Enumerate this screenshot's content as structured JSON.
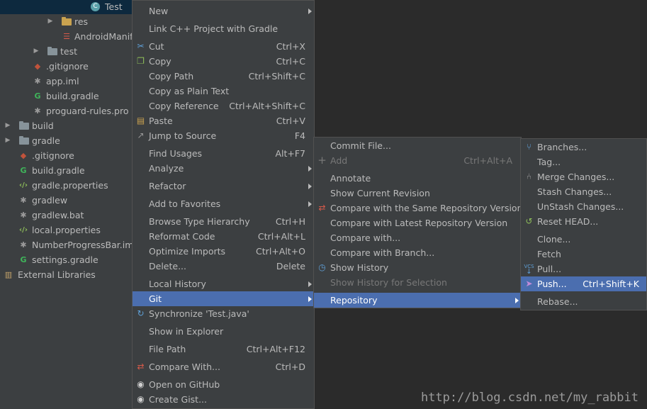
{
  "tree": {
    "items": [
      {
        "label": "Test",
        "icon": "class-icon"
      },
      {
        "label": "res",
        "icon": "folder-icon"
      },
      {
        "label": "AndroidManif",
        "icon": "xml-icon"
      },
      {
        "label": "test",
        "icon": "folder-icon"
      },
      {
        "label": ".gitignore",
        "icon": "git-icon"
      },
      {
        "label": "app.iml",
        "icon": "file-icon"
      },
      {
        "label": "build.gradle",
        "icon": "gradle-icon"
      },
      {
        "label": "proguard-rules.pro",
        "icon": "file-icon"
      },
      {
        "label": "build",
        "icon": "folder-icon"
      },
      {
        "label": "gradle",
        "icon": "folder-icon"
      },
      {
        "label": ".gitignore",
        "icon": "git-icon"
      },
      {
        "label": "build.gradle",
        "icon": "gradle-icon"
      },
      {
        "label": "gradle.properties",
        "icon": "properties-icon"
      },
      {
        "label": "gradlew",
        "icon": "file-icon"
      },
      {
        "label": "gradlew.bat",
        "icon": "file-icon"
      },
      {
        "label": "local.properties",
        "icon": "properties-icon"
      },
      {
        "label": "NumberProgressBar.iml",
        "icon": "file-icon"
      },
      {
        "label": "settings.gradle",
        "icon": "gradle-icon"
      },
      {
        "label": "External Libraries",
        "icon": "library-icon"
      }
    ]
  },
  "context_menu": {
    "items": [
      {
        "label": "New",
        "shortcut": ""
      },
      {
        "label": "Link C++ Project with Gradle",
        "shortcut": ""
      },
      {
        "label": "Cut",
        "shortcut": "Ctrl+X"
      },
      {
        "label": "Copy",
        "shortcut": "Ctrl+C"
      },
      {
        "label": "Copy Path",
        "shortcut": "Ctrl+Shift+C"
      },
      {
        "label": "Copy as Plain Text",
        "shortcut": ""
      },
      {
        "label": "Copy Reference",
        "shortcut": "Ctrl+Alt+Shift+C"
      },
      {
        "label": "Paste",
        "shortcut": "Ctrl+V"
      },
      {
        "label": "Jump to Source",
        "shortcut": "F4"
      },
      {
        "label": "Find Usages",
        "shortcut": "Alt+F7"
      },
      {
        "label": "Analyze",
        "shortcut": ""
      },
      {
        "label": "Refactor",
        "shortcut": ""
      },
      {
        "label": "Add to Favorites",
        "shortcut": ""
      },
      {
        "label": "Browse Type Hierarchy",
        "shortcut": "Ctrl+H"
      },
      {
        "label": "Reformat Code",
        "shortcut": "Ctrl+Alt+L"
      },
      {
        "label": "Optimize Imports",
        "shortcut": "Ctrl+Alt+O"
      },
      {
        "label": "Delete...",
        "shortcut": "Delete"
      },
      {
        "label": "Local History",
        "shortcut": ""
      },
      {
        "label": "Git",
        "shortcut": ""
      },
      {
        "label": "Synchronize 'Test.java'",
        "shortcut": ""
      },
      {
        "label": "Show in Explorer",
        "shortcut": ""
      },
      {
        "label": "File Path",
        "shortcut": "Ctrl+Alt+F12"
      },
      {
        "label": "Compare With...",
        "shortcut": "Ctrl+D"
      },
      {
        "label": "Open on GitHub",
        "shortcut": ""
      },
      {
        "label": "Create Gist...",
        "shortcut": ""
      }
    ]
  },
  "git_menu": {
    "items": [
      {
        "label": "Commit File...",
        "shortcut": ""
      },
      {
        "label": "Add",
        "shortcut": "Ctrl+Alt+A"
      },
      {
        "label": "Annotate",
        "shortcut": ""
      },
      {
        "label": "Show Current Revision",
        "shortcut": ""
      },
      {
        "label": "Compare with the Same Repository Version",
        "shortcut": ""
      },
      {
        "label": "Compare with Latest Repository Version",
        "shortcut": ""
      },
      {
        "label": "Compare with...",
        "shortcut": ""
      },
      {
        "label": "Compare with Branch...",
        "shortcut": ""
      },
      {
        "label": "Show History",
        "shortcut": ""
      },
      {
        "label": "Show History for Selection",
        "shortcut": ""
      },
      {
        "label": "Repository",
        "shortcut": ""
      }
    ]
  },
  "repository_menu": {
    "items": [
      {
        "label": "Branches...",
        "shortcut": ""
      },
      {
        "label": "Tag...",
        "shortcut": ""
      },
      {
        "label": "Merge Changes...",
        "shortcut": ""
      },
      {
        "label": "Stash Changes...",
        "shortcut": ""
      },
      {
        "label": "UnStash Changes...",
        "shortcut": ""
      },
      {
        "label": "Reset HEAD...",
        "shortcut": ""
      },
      {
        "label": "Clone...",
        "shortcut": ""
      },
      {
        "label": "Fetch",
        "shortcut": ""
      },
      {
        "label": "Pull...",
        "shortcut": ""
      },
      {
        "label": "Push...",
        "shortcut": "Ctrl+Shift+K"
      },
      {
        "label": "Rebase...",
        "shortcut": ""
      }
    ]
  },
  "vcs_badge": "VCS",
  "watermark": "http://blog.csdn.net/my_rabbit",
  "colors": {
    "highlight": "#4b6eaf",
    "menu_bg": "#3c3f41",
    "editor_bg": "#2b2b2b"
  }
}
